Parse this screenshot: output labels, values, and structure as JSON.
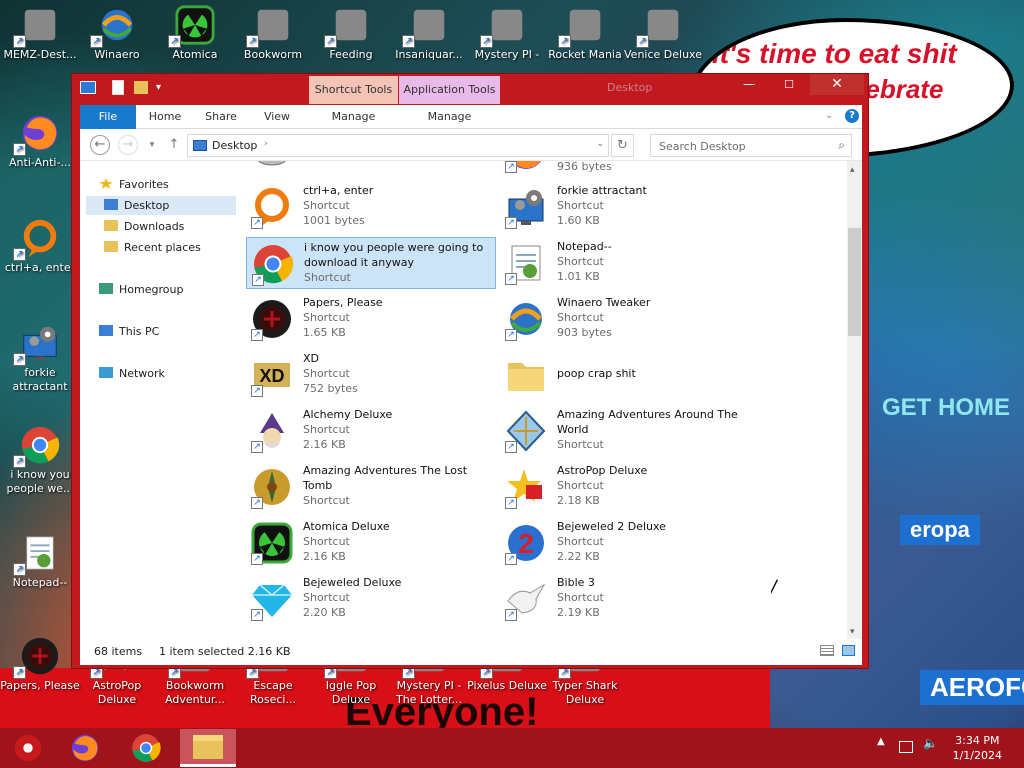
{
  "wallpaper": {
    "bubble_line1": "it's time to eat shit",
    "bubble_line2": "/celebrate",
    "strip_text": "Everyone!",
    "sign1": "GET HOME",
    "sign2": "eropa",
    "sign3": "AEROFOS"
  },
  "desktop_icons": [
    {
      "label": "MEMZ-Dest...",
      "icon": "recycle-bin-icon"
    },
    {
      "label": "Winaero",
      "icon": "winaero-icon"
    },
    {
      "label": "Atomica",
      "icon": "atomica-icon"
    },
    {
      "label": "Bookworm",
      "icon": "bookworm-icon"
    },
    {
      "label": "Feeding",
      "icon": "feeding-icon"
    },
    {
      "label": "Insaniquar...",
      "icon": "fish-icon"
    },
    {
      "label": "Mystery PI -",
      "icon": "mystery-pi-icon"
    },
    {
      "label": "Rocket Mania",
      "icon": "rocket-icon"
    },
    {
      "label": "Venice Deluxe",
      "icon": "venice-icon"
    },
    {
      "label": "Anti-Anti-...",
      "icon": "firefox-icon"
    },
    {
      "label": "ctrl+a, enter",
      "icon": "orange-ring-icon"
    },
    {
      "label": "forkie attractant",
      "icon": "gear-monitor-icon"
    },
    {
      "label": "i know you people we...",
      "icon": "chrome-icon"
    },
    {
      "label": "Notepad--",
      "icon": "notepad-icon"
    },
    {
      "label": "Papers, Please",
      "icon": "papers-please-icon"
    },
    {
      "label": "AstroPop Deluxe",
      "icon": "astropop-icon"
    },
    {
      "label": "Bookworm Adventur...",
      "icon": "bookworm-adventures-icon"
    },
    {
      "label": "Escape Roseci...",
      "icon": "escape-icon"
    },
    {
      "label": "Iggle Pop Deluxe",
      "icon": "iggle-pop-icon"
    },
    {
      "label": "Mystery PI - The Lotter...",
      "icon": "mystery-pi-lottery-icon"
    },
    {
      "label": "Pixelus Deluxe",
      "icon": "pixelus-icon"
    },
    {
      "label": "Typer Shark Deluxe",
      "icon": "typer-shark-icon"
    }
  ],
  "window": {
    "title": "Desktop",
    "context_tabs": [
      "Shortcut Tools",
      "Application Tools"
    ],
    "ribbon_tabs": [
      "File",
      "Home",
      "Share",
      "View",
      "Manage",
      "Manage"
    ],
    "controls": {
      "minimize": "—",
      "maximize": "☐",
      "close": "✕"
    },
    "address": {
      "location": "Desktop",
      "search_placeholder": "Search Desktop"
    },
    "nav_pane": [
      {
        "label": "Favorites",
        "icon": "star-icon"
      },
      {
        "label": "Desktop",
        "icon": "desktop-icon"
      },
      {
        "label": "Downloads",
        "icon": "downloads-icon"
      },
      {
        "label": "Recent places",
        "icon": "recent-places-icon"
      },
      {
        "label": "Homegroup",
        "icon": "homegroup-icon"
      },
      {
        "label": "This PC",
        "icon": "this-pc-icon"
      },
      {
        "label": "Network",
        "icon": "network-icon"
      }
    ],
    "files": [
      {
        "name": "",
        "type": "",
        "size": "",
        "icon": "disc-icon"
      },
      {
        "name": "",
        "type": "",
        "size": "936 bytes",
        "icon": "firefox-icon"
      },
      {
        "name": "ctrl+a, enter",
        "type": "Shortcut",
        "size": "1001 bytes",
        "icon": "orange-ring-icon"
      },
      {
        "name": "forkie attractant",
        "type": "Shortcut",
        "size": "1.60 KB",
        "icon": "gear-monitor-icon"
      },
      {
        "name": "i know you people were going to download it anyway",
        "type": "Shortcut",
        "size": "",
        "icon": "chrome-icon",
        "selected": true
      },
      {
        "name": "Notepad--",
        "type": "Shortcut",
        "size": "1.01 KB",
        "icon": "notepad-icon"
      },
      {
        "name": "Papers, Please",
        "type": "Shortcut",
        "size": "1.65 KB",
        "icon": "papers-please-icon"
      },
      {
        "name": "Winaero Tweaker",
        "type": "Shortcut",
        "size": "903 bytes",
        "icon": "winaero-icon"
      },
      {
        "name": "XD",
        "type": "Shortcut",
        "size": "752 bytes",
        "icon": "xd-icon"
      },
      {
        "name": "poop crap shit",
        "type": "",
        "size": "",
        "icon": "folder-icon"
      },
      {
        "name": "Alchemy Deluxe",
        "type": "Shortcut",
        "size": "2.16 KB",
        "icon": "alchemy-icon"
      },
      {
        "name": "Amazing Adventures Around The World",
        "type": "Shortcut",
        "size": "",
        "icon": "amazing-adventures-world-icon"
      },
      {
        "name": "Amazing Adventures The Lost Tomb",
        "type": "Shortcut",
        "size": "",
        "icon": "amazing-adventures-tomb-icon"
      },
      {
        "name": "AstroPop Deluxe",
        "type": "Shortcut",
        "size": "2.18 KB",
        "icon": "astropop-icon"
      },
      {
        "name": "Atomica Deluxe",
        "type": "Shortcut",
        "size": "2.16 KB",
        "icon": "atomica-icon"
      },
      {
        "name": "Bejeweled 2 Deluxe",
        "type": "Shortcut",
        "size": "2.22 KB",
        "icon": "bejeweled-2-icon"
      },
      {
        "name": "Bejeweled Deluxe",
        "type": "Shortcut",
        "size": "2.20 KB",
        "icon": "bejeweled-icon"
      },
      {
        "name": "Bible 3",
        "type": "Shortcut",
        "size": "2.19 KB",
        "icon": "bible-dove-icon"
      }
    ],
    "status": {
      "count": "68 items",
      "selection": "1 item selected  2.16 KB"
    }
  },
  "taskbar": {
    "apps": [
      {
        "name": "start",
        "icon": "start-icon"
      },
      {
        "name": "firefox",
        "icon": "firefox-icon"
      },
      {
        "name": "chrome",
        "icon": "chrome-icon"
      },
      {
        "name": "file-explorer",
        "icon": "file-explorer-icon",
        "active": true
      }
    ],
    "time": "3:34 PM",
    "date": "1/1/2024"
  },
  "colors": {
    "window_frame": "#c01a1e",
    "taskbar": "#a1131b",
    "file_tab": "#1979ca",
    "selection": "#cce4f7"
  }
}
